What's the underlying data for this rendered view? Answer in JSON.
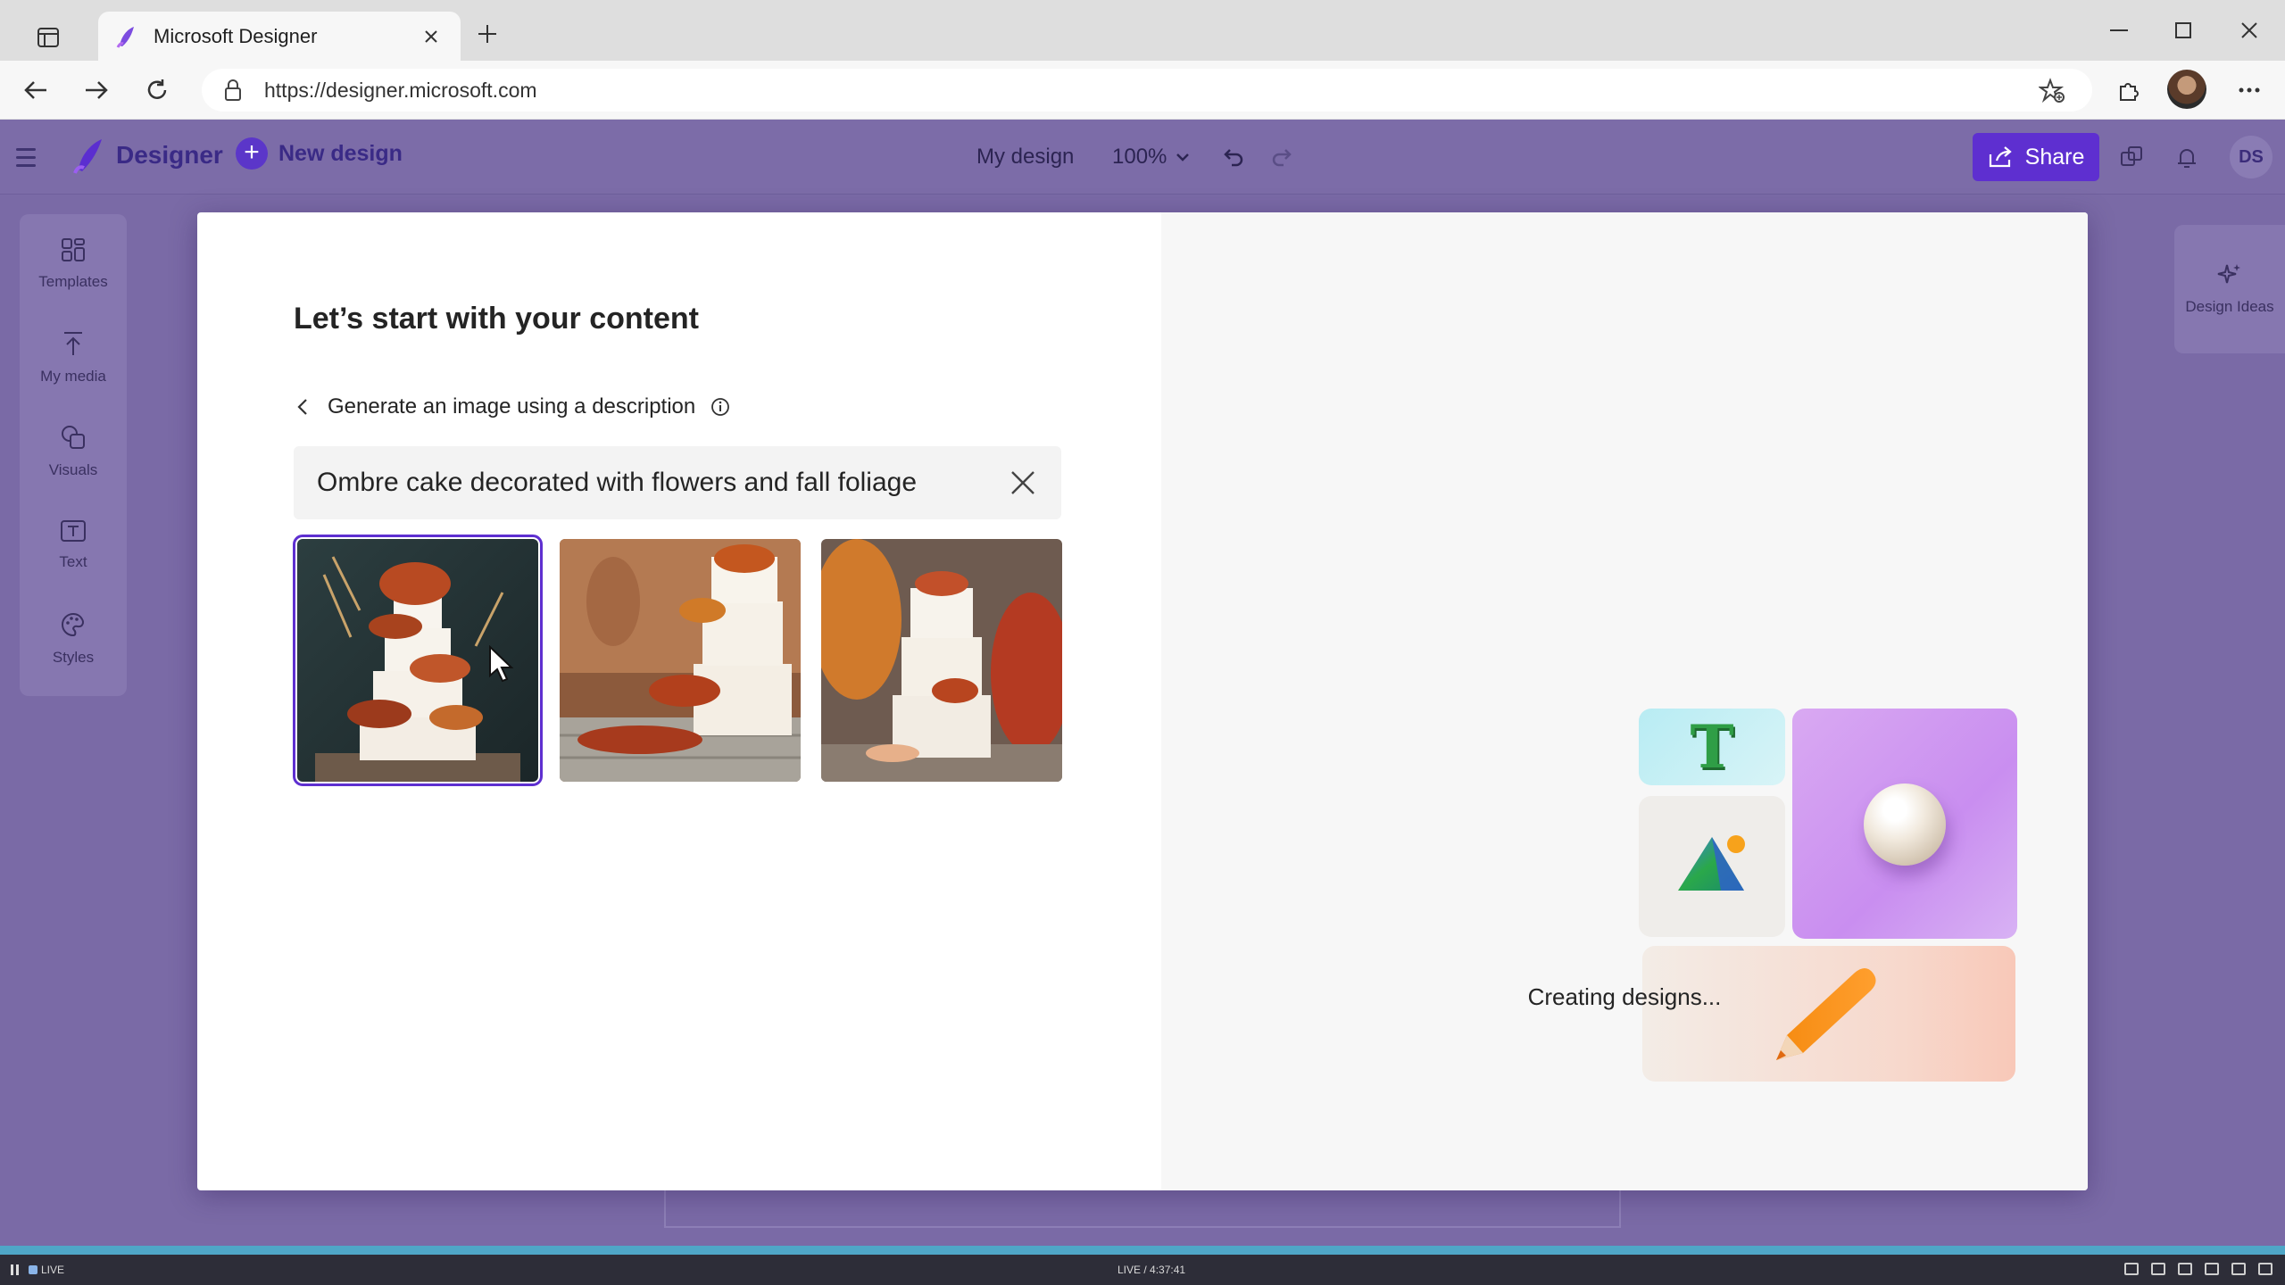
{
  "browser": {
    "tab_title": "Microsoft Designer",
    "url": "https://designer.microsoft.com"
  },
  "app": {
    "brand": "Designer",
    "new_design_label": "New design",
    "doc_title": "My design",
    "zoom": "100%",
    "share_label": "Share",
    "user_initials": "DS"
  },
  "left_rail": [
    {
      "label": "Templates",
      "icon": "templates-icon"
    },
    {
      "label": "My media",
      "icon": "upload-icon"
    },
    {
      "label": "Visuals",
      "icon": "visuals-icon"
    },
    {
      "label": "Text",
      "icon": "text-icon"
    },
    {
      "label": "Styles",
      "icon": "palette-icon"
    }
  ],
  "right_rail": {
    "label": "Design Ideas",
    "icon": "sparkle-icon"
  },
  "dialog": {
    "heading": "Let’s start with your content",
    "back_label": "Generate an image using a description",
    "prompt_value": "Ombre cake decorated with flowers and fall foliage",
    "thumbnails": [
      {
        "name": "cake-image-1",
        "selected": true
      },
      {
        "name": "cake-image-2",
        "selected": false
      },
      {
        "name": "cake-image-3",
        "selected": false
      }
    ],
    "status": "Creating designs...",
    "illustration_letter": "T"
  },
  "statusbar": {
    "live": "LIVE",
    "timecode": "LIVE / 4:37:41"
  },
  "colors": {
    "accent": "#5e2fd0",
    "app_bg": "#7a6aa6",
    "progress": "#4fa6c7"
  }
}
